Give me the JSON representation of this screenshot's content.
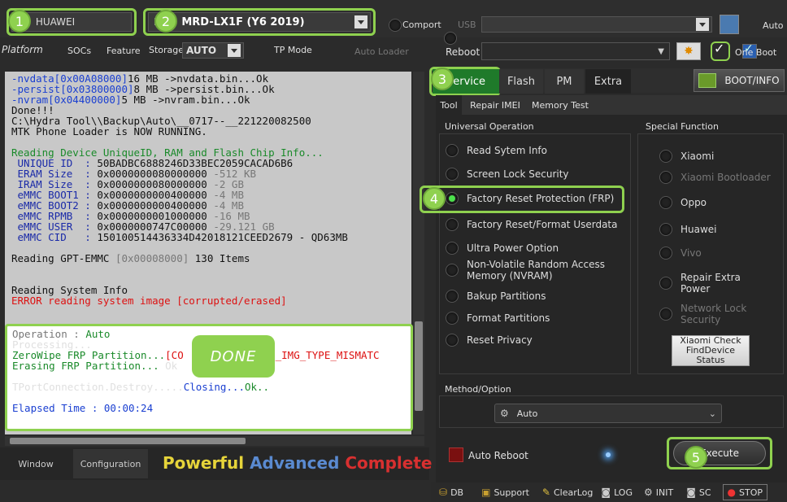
{
  "badges": [
    "1",
    "2",
    "3",
    "4",
    "5"
  ],
  "top": {
    "brand": "HUAWEI",
    "model_prefix": "M",
    "model": "MRD-LX1F (Y6 2019)",
    "comport_label": "Comport",
    "usb_label": "USB",
    "auto_label": "Auto"
  },
  "platform": {
    "label": "Platform",
    "socs": "SOCs",
    "feature": "Feature",
    "storage_label": "Storage",
    "storage_value": "AUTO",
    "tp_mode": "TP Mode",
    "auto_loader": "Auto Loader",
    "reboot_label": "Reboot",
    "one_boot": "One Boot"
  },
  "log": {
    "lines": [
      {
        "segs": [
          [
            "-nvdata[0x00A08000]",
            "c-blue"
          ],
          [
            "16 MB ->nvdata.bin...Ok",
            ""
          ]
        ]
      },
      {
        "segs": [
          [
            "-persist[0x03800000]",
            "c-blue"
          ],
          [
            "8 MB ->persist.bin...Ok",
            ""
          ]
        ]
      },
      {
        "segs": [
          [
            "-nvram[0x04400000]",
            "c-blue"
          ],
          [
            "5 MB ->nvram.bin...Ok",
            ""
          ]
        ]
      },
      {
        "segs": [
          [
            "Done!!!",
            ""
          ]
        ]
      },
      {
        "segs": [
          [
            "C:\\Hydra Tool\\\\Backup\\Auto\\__0717--__221220082500",
            ""
          ]
        ]
      },
      {
        "segs": [
          [
            "MTK Phone Loader is NOW RUNNING.",
            ""
          ]
        ]
      },
      {
        "segs": [
          [
            "",
            ""
          ]
        ]
      },
      {
        "segs": [
          [
            "Reading Device UniqueID, RAM and Flash Chip Info...",
            "c-green"
          ]
        ]
      },
      {
        "segs": [
          [
            " UNIQUE ID  : ",
            "c-navy"
          ],
          [
            "50BADBC6888246D33BEC2059CACAD6B6",
            ""
          ]
        ]
      },
      {
        "segs": [
          [
            " ERAM Size  : ",
            "c-navy"
          ],
          [
            "0x0000000080000000 ",
            ""
          ],
          [
            "-512 KB",
            "c-gray"
          ]
        ]
      },
      {
        "segs": [
          [
            " IRAM Size  : ",
            "c-navy"
          ],
          [
            "0x0000000080000000 ",
            ""
          ],
          [
            "-2 GB",
            "c-gray"
          ]
        ]
      },
      {
        "segs": [
          [
            " eMMC BOOT1 : ",
            "c-navy"
          ],
          [
            "0x0000000000400000 ",
            ""
          ],
          [
            "-4 MB",
            "c-gray"
          ]
        ]
      },
      {
        "segs": [
          [
            " eMMC BOOT2 : ",
            "c-navy"
          ],
          [
            "0x0000000000400000 ",
            ""
          ],
          [
            "-4 MB",
            "c-gray"
          ]
        ]
      },
      {
        "segs": [
          [
            " eMMC RPMB  : ",
            "c-navy"
          ],
          [
            "0x0000000001000000 ",
            ""
          ],
          [
            "-16 MB",
            "c-gray"
          ]
        ]
      },
      {
        "segs": [
          [
            " eMMC USER  : ",
            "c-navy"
          ],
          [
            "0x0000000747C00000 ",
            ""
          ],
          [
            "-29.121 GB",
            "c-gray"
          ]
        ]
      },
      {
        "segs": [
          [
            " eMMC CID   : ",
            "c-navy"
          ],
          [
            "150100514436334D42018121CEED2679 - QD63MB",
            ""
          ]
        ]
      },
      {
        "segs": [
          [
            "",
            ""
          ]
        ]
      },
      {
        "segs": [
          [
            "Reading GPT-EMMC ",
            ""
          ],
          [
            "[0x00008000]",
            "c-gray"
          ],
          [
            " 130 Items",
            ""
          ]
        ]
      },
      {
        "segs": [
          [
            "",
            ""
          ]
        ]
      },
      {
        "segs": [
          [
            "",
            ""
          ]
        ]
      },
      {
        "segs": [
          [
            "Reading System Info",
            ""
          ]
        ]
      },
      {
        "segs": [
          [
            "ERROR reading system image [corrupted/erased]",
            "c-red"
          ]
        ]
      }
    ],
    "bottom": [
      {
        "segs": [
          [
            "Operation : ",
            "c-gray"
          ],
          [
            "Auto",
            "c-green"
          ]
        ]
      },
      {
        "segs": [
          [
            "Processing...",
            ""
          ]
        ]
      },
      {
        "segs": [
          [
            "ZeroWipe FRP Partition...",
            "c-green"
          ],
          [
            "[CO",
            "c-red"
          ],
          [
            "          ",
            "c-red"
          ],
          [
            "S_SEC_IMG_TYPE_MISMATC",
            "c-red"
          ]
        ]
      },
      {
        "segs": [
          [
            "Erasing FRP Partition...",
            "c-green"
          ],
          [
            " Ok",
            ""
          ]
        ]
      },
      {
        "segs": [
          [
            "",
            ""
          ]
        ]
      },
      {
        "segs": [
          [
            "TPortConnection.Destroy.....",
            ""
          ],
          [
            "Closing...",
            "c-blue"
          ],
          [
            "Ok..",
            "c-green"
          ]
        ]
      },
      {
        "segs": [
          [
            "",
            ""
          ]
        ]
      },
      {
        "segs": [
          [
            "Elapsed Time : 00:00:24",
            "c-blue"
          ]
        ]
      }
    ],
    "done_label": "DONE"
  },
  "bottom_left": {
    "window_tab": "Window",
    "config_tab": "Configuration",
    "slogan1": "Powerful",
    "slogan2": "Advanced",
    "slogan3": "Complete"
  },
  "tabs": {
    "service": "Service",
    "flash": "Flash",
    "pm": "PM",
    "extra": "Extra",
    "boot_info": "BOOT/INFO"
  },
  "subtabs": {
    "tool": "Tool",
    "repair_imei": "Repair IMEI",
    "memory_test": "Memory Test"
  },
  "universal": {
    "title": "Universal Operation",
    "items": [
      "Read Sytem Info",
      "Screen Lock Security",
      "Factory Reset Protection (FRP)",
      "Factory Reset/Format Userdata",
      "Ultra Power Option",
      "Non-Volatile Random Access Memory (NVRAM)",
      "Bakup Partitions",
      "Format Partitions",
      "Reset Privacy"
    ]
  },
  "special": {
    "title": "Special Function",
    "items": [
      "Xiaomi",
      "Xiaomi Bootloader",
      "Oppo",
      "Huawei",
      "Vivo",
      "Repair Extra Power",
      "Network Lock Security"
    ],
    "xiaomi_btn": "Xiaomi Check FindDevice Status"
  },
  "method": {
    "title": "Method/Option",
    "value": "Auto"
  },
  "auto_reboot": "Auto Reboot",
  "execute": "Execute",
  "statusbar": {
    "db": "DB",
    "support": "Support",
    "clearlog": "ClearLog",
    "log": "LOG",
    "init": "INIT",
    "sc": "SC",
    "stop": "STOP"
  },
  "colors": {
    "accent": "#8fd14f",
    "service_tab": "#1f7a2a"
  }
}
